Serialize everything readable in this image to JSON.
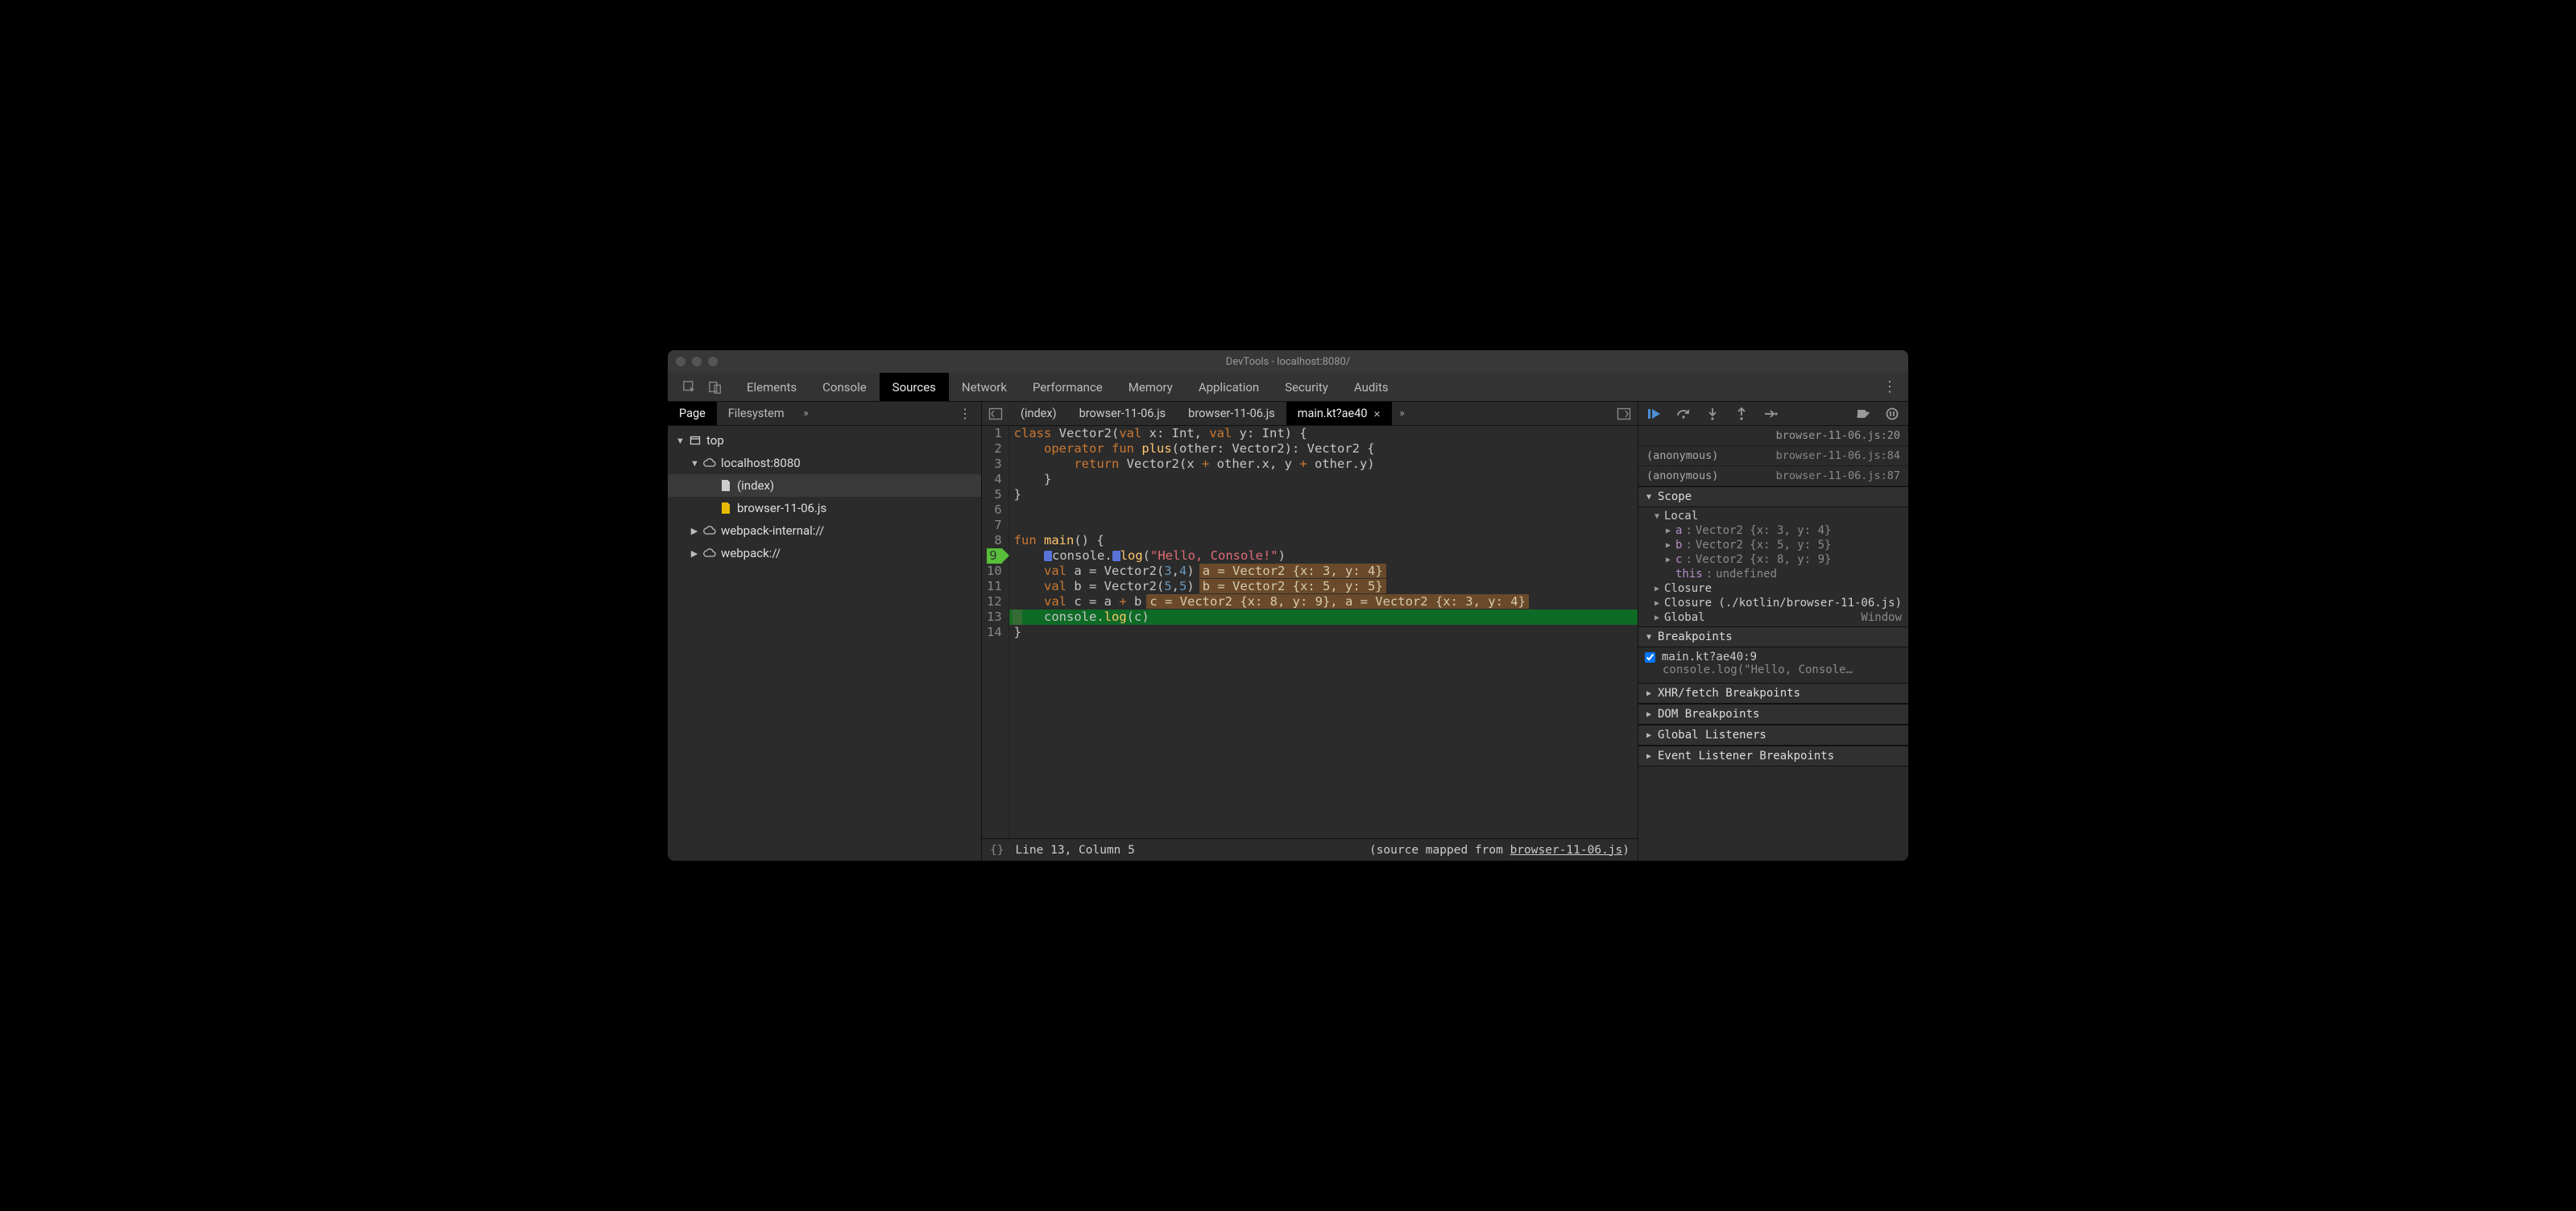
{
  "window": {
    "title": "DevTools - localhost:8080/"
  },
  "top_tabs": [
    {
      "label": "Elements",
      "active": false
    },
    {
      "label": "Console",
      "active": false
    },
    {
      "label": "Sources",
      "active": true
    },
    {
      "label": "Network",
      "active": false
    },
    {
      "label": "Performance",
      "active": false
    },
    {
      "label": "Memory",
      "active": false
    },
    {
      "label": "Application",
      "active": false
    },
    {
      "label": "Security",
      "active": false
    },
    {
      "label": "Audits",
      "active": false
    }
  ],
  "left": {
    "tabs": [
      {
        "label": "Page",
        "active": true
      },
      {
        "label": "Filesystem",
        "active": false
      }
    ],
    "tree": {
      "top": "top",
      "host": "localhost:8080",
      "index": "(index)",
      "jsfile": "browser-11-06.js",
      "wpinternal": "webpack-internal://",
      "wp": "webpack://"
    }
  },
  "editor": {
    "file_tabs": [
      {
        "label": "(index)",
        "active": false,
        "closable": false
      },
      {
        "label": "browser-11-06.js",
        "active": false,
        "closable": false
      },
      {
        "label": "browser-11-06.js",
        "active": false,
        "closable": false
      },
      {
        "label": "main.kt?ae40",
        "active": true,
        "closable": true
      }
    ],
    "gutter": [
      "1",
      "2",
      "3",
      "4",
      "5",
      "6",
      "7",
      "8",
      "9",
      "10",
      "11",
      "12",
      "13",
      "14"
    ],
    "bp_line_index": 8,
    "code_tokens": {
      "l1": {
        "a": "class ",
        "b": "Vector2",
        "c": "(",
        "d": "val",
        "e": " x: ",
        "f": "Int",
        "g": ", ",
        "h": "val",
        "i": " y: ",
        "j": "Int",
        "k": ") {"
      },
      "l2": {
        "a": "    ",
        "b": "operator fun ",
        "c": "plus",
        "d": "(other: ",
        "e": "Vector2",
        "f": "): ",
        "g": "Vector2",
        "h": " {"
      },
      "l3": {
        "a": "        ",
        "b": "return ",
        "c": "Vector2",
        "d": "(x ",
        "e": "+",
        "f": " other.x, y ",
        "g": "+",
        "h": " other.y)"
      },
      "l4": {
        "a": "    }"
      },
      "l5": {
        "a": "}"
      },
      "l6": {
        "a": ""
      },
      "l7": {
        "a": ""
      },
      "l8": {
        "a": "fun ",
        "b": "main",
        "c": "() {"
      },
      "l9": {
        "a": "    ",
        "b": "console.",
        "c": "log",
        "d": "(",
        "e": "\"Hello, Console!\"",
        "f": ")"
      },
      "l10": {
        "a": "    ",
        "b": "val",
        "c": " a = Vector2(",
        "d": "3",
        "e": ",",
        "f": "4",
        "g": ")",
        "inline": "a = Vector2 {x: 3, y: 4}"
      },
      "l11": {
        "a": "    ",
        "b": "val",
        "c": " b = Vector2(",
        "d": "5",
        "e": ",",
        "f": "5",
        "g": ")",
        "inline": "b = Vector2 {x: 5, y: 5}"
      },
      "l12": {
        "a": "    ",
        "b": "val",
        "c": " c = a ",
        "d": "+",
        "e": " b",
        "inline": "c = Vector2 {x: 8, y: 9}, a = Vector2 {x: 3, y: 4}"
      },
      "l13": {
        "a": "    console.",
        "b": "log",
        "c": "(c)"
      },
      "l14": {
        "a": "}"
      }
    },
    "footer": {
      "format_icon": "{}",
      "pos": "Line 13, Column 5",
      "mapped_prefix": "(source mapped from ",
      "mapped_link": "browser-11-06.js",
      "mapped_suffix": ")"
    }
  },
  "debugger": {
    "stack_top_loc": "browser-11-06.js:20",
    "stack": [
      {
        "fn": "(anonymous)",
        "loc": "browser-11-06.js:84"
      },
      {
        "fn": "(anonymous)",
        "loc": "browser-11-06.js:87"
      }
    ],
    "scope_header": "Scope",
    "scope": {
      "local_label": "Local",
      "vars": [
        {
          "name": "a",
          "value": "Vector2 {x: 3, y: 4}"
        },
        {
          "name": "b",
          "value": "Vector2 {x: 5, y: 5}"
        },
        {
          "name": "c",
          "value": "Vector2 {x: 8, y: 9}"
        }
      ],
      "this_label": "this",
      "this_value": "undefined",
      "closure_label": "Closure",
      "closure2_label": "Closure (./kotlin/browser-11-06.js)",
      "global_label": "Global",
      "global_value": "Window"
    },
    "breakpoints_header": "Breakpoints",
    "breakpoint": {
      "label": "main.kt?ae40:9",
      "preview": "console.log(\"Hello, Console…"
    },
    "xhr_header": "XHR/fetch Breakpoints",
    "dom_header": "DOM Breakpoints",
    "global_listeners_header": "Global Listeners",
    "event_header": "Event Listener Breakpoints"
  }
}
